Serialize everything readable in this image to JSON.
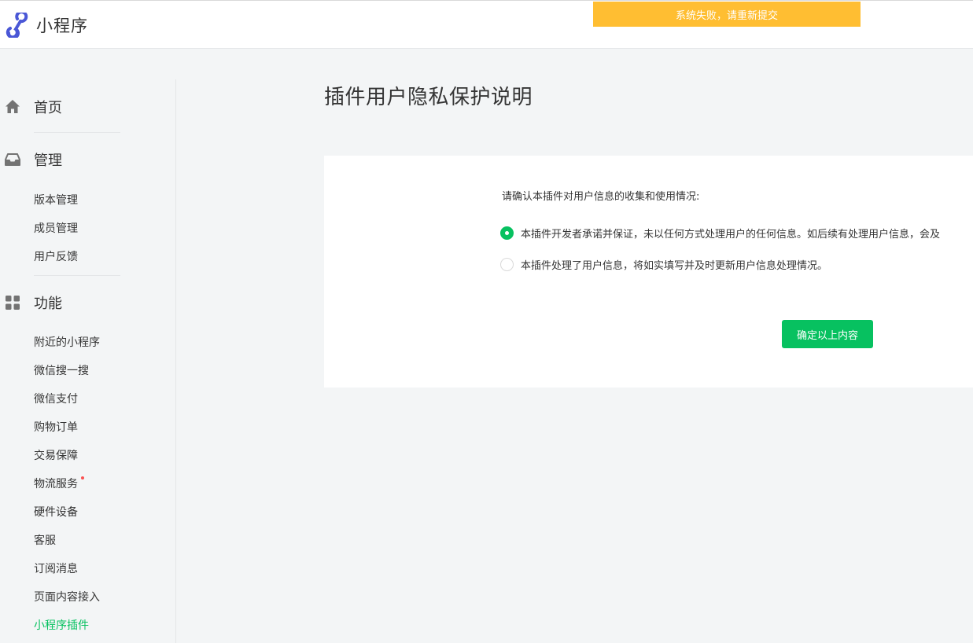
{
  "header": {
    "app_name": "小程序",
    "logo_icon": "miniprogram-logo-icon",
    "brand_color": "#4a57d6"
  },
  "toast": {
    "message": "系统失败，请重新提交",
    "color": "#ffbe32"
  },
  "sidebar": {
    "home": {
      "label": "首页",
      "icon": "home-icon"
    },
    "manage": {
      "label": "管理",
      "icon": "inbox-icon",
      "items": [
        {
          "label": "版本管理"
        },
        {
          "label": "成员管理"
        },
        {
          "label": "用户反馈"
        }
      ]
    },
    "features": {
      "label": "功能",
      "icon": "grid-icon",
      "items": [
        {
          "label": "附近的小程序"
        },
        {
          "label": "微信搜一搜"
        },
        {
          "label": "微信支付"
        },
        {
          "label": "购物订单"
        },
        {
          "label": "交易保障"
        },
        {
          "label": "物流服务",
          "badge": "red-dot"
        },
        {
          "label": "硬件设备"
        },
        {
          "label": "客服"
        },
        {
          "label": "订阅消息"
        },
        {
          "label": "页面内容接入"
        },
        {
          "label": "小程序插件",
          "active": true
        }
      ]
    },
    "active_color": "#07c160"
  },
  "main": {
    "title": "插件用户隐私保护说明",
    "question": "请确认本插件对用户信息的收集和使用情况:",
    "options": [
      {
        "label": "本插件开发者承诺并保证，未以任何方式处理用户的任何信息。如后续有处理用户信息，会及",
        "checked": true
      },
      {
        "label": "本插件处理了用户信息，将如实填写并及时更新用户信息处理情况。",
        "checked": false
      }
    ],
    "confirm_label": "确定以上内容",
    "accent_color": "#07c160"
  }
}
